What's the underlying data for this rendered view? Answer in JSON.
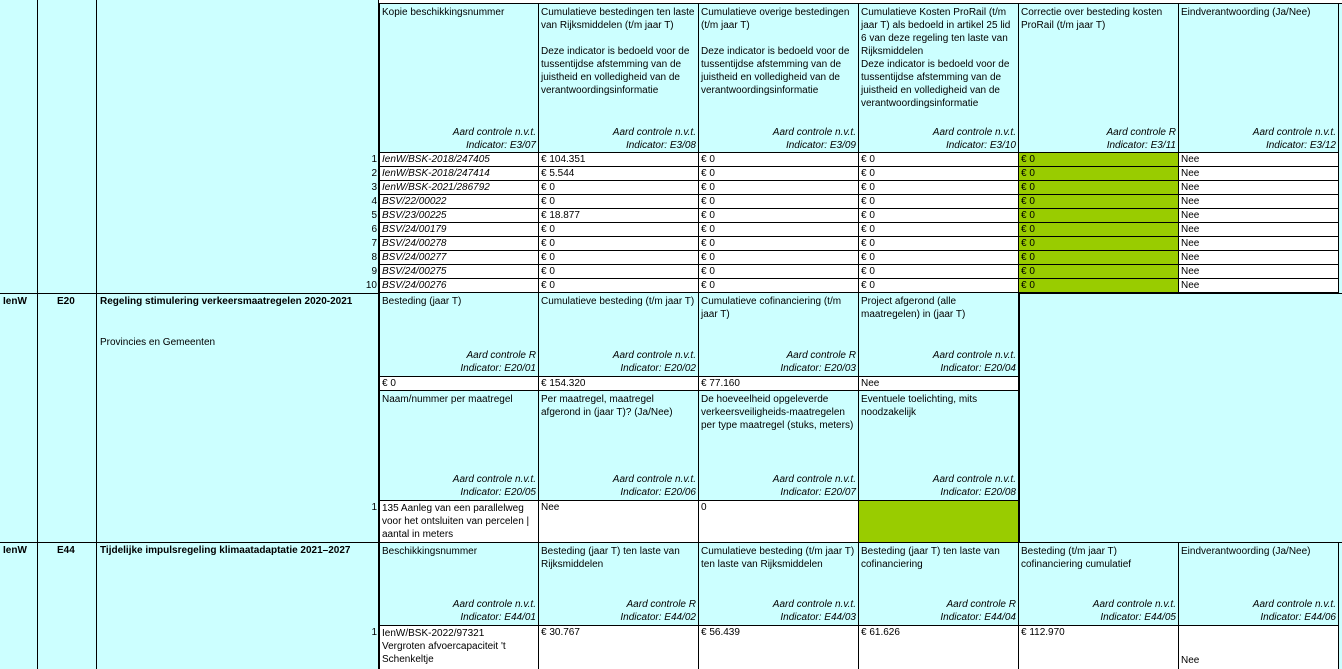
{
  "partial_top": [
    "IenW/BSK-2018/247405",
    "€ 0",
    "€ 0",
    "€ 0",
    "€ 0",
    "€ 0"
  ],
  "e3": {
    "headers": [
      {
        "label": "Kopie beschikkingsnummer",
        "aard": "Aard controle n.v.t.",
        "indicator": "Indicator: E3/07"
      },
      {
        "label": "Cumulatieve bestedingen ten laste van Rijksmiddelen (t/m jaar T)\n\nDeze indicator is bedoeld voor de tussentijdse afstemming van de juistheid en volledigheid van de verantwoordingsinformatie",
        "aard": "Aard controle n.v.t.",
        "indicator": "Indicator: E3/08"
      },
      {
        "label": "Cumulatieve overige bestedingen (t/m jaar T)\n\nDeze indicator is bedoeld voor de tussentijdse afstemming van de juistheid en volledigheid van de verantwoordingsinformatie",
        "aard": "Aard controle n.v.t.",
        "indicator": "Indicator: E3/09"
      },
      {
        "label": "Cumulatieve Kosten ProRail (t/m jaar T) als bedoeld in artikel 25 lid 6 van deze regeling ten laste van Rijksmiddelen\nDeze indicator is bedoeld voor de tussentijdse afstemming van de juistheid en volledigheid van de verantwoordingsinformatie",
        "aard": "Aard controle n.v.t.",
        "indicator": "Indicator: E3/10"
      },
      {
        "label": "Correctie over besteding kosten ProRail (t/m jaar T)",
        "aard": "Aard controle R",
        "indicator": "Indicator: E3/11"
      },
      {
        "label": "Eindverantwoording (Ja/Nee)",
        "aard": "Aard controle n.v.t.",
        "indicator": "Indicator: E3/12"
      }
    ],
    "rows": [
      {
        "n": "1",
        "nr": "IenW/BSK-2018/247405",
        "a": "€ 104.351",
        "b": "€ 0",
        "c": "€ 0",
        "d": "€ 0",
        "e": "Nee"
      },
      {
        "n": "2",
        "nr": "IenW/BSK-2018/247414",
        "a": "€ 5.544",
        "b": "€ 0",
        "c": "€ 0",
        "d": "€ 0",
        "e": "Nee"
      },
      {
        "n": "3",
        "nr": "IenW/BSK-2021/286792",
        "a": "€ 0",
        "b": "€ 0",
        "c": "€ 0",
        "d": "€ 0",
        "e": "Nee"
      },
      {
        "n": "4",
        "nr": "BSV/22/00022",
        "a": "€ 0",
        "b": "€ 0",
        "c": "€ 0",
        "d": "€ 0",
        "e": "Nee"
      },
      {
        "n": "5",
        "nr": "BSV/23/00225",
        "a": "€ 18.877",
        "b": "€ 0",
        "c": "€ 0",
        "d": "€ 0",
        "e": "Nee"
      },
      {
        "n": "6",
        "nr": "BSV/24/00179",
        "a": "€ 0",
        "b": "€ 0",
        "c": "€ 0",
        "d": "€ 0",
        "e": "Nee"
      },
      {
        "n": "7",
        "nr": "BSV/24/00278",
        "a": "€ 0",
        "b": "€ 0",
        "c": "€ 0",
        "d": "€ 0",
        "e": "Nee"
      },
      {
        "n": "8",
        "nr": "BSV/24/00277",
        "a": "€ 0",
        "b": "€ 0",
        "c": "€ 0",
        "d": "€ 0",
        "e": "Nee"
      },
      {
        "n": "9",
        "nr": "BSV/24/00275",
        "a": "€ 0",
        "b": "€ 0",
        "c": "€ 0",
        "d": "€ 0",
        "e": "Nee"
      },
      {
        "n": "10",
        "nr": "BSV/24/00276",
        "a": "€ 0",
        "b": "€ 0",
        "c": "€ 0",
        "d": "€ 0",
        "e": "Nee"
      }
    ],
    "highlight_color": "#99cc00"
  },
  "e20": {
    "ministry": "IenW",
    "code": "E20",
    "title": "Regeling stimulering verkeersmaatregelen 2020-2021",
    "recipients": "Provincies en Gemeenten",
    "headers1": [
      {
        "label": "Besteding (jaar T)",
        "aard": "Aard controle R",
        "indicator": "Indicator: E20/01"
      },
      {
        "label": "Cumulatieve besteding (t/m jaar T)",
        "aard": "Aard controle n.v.t.",
        "indicator": "Indicator: E20/02"
      },
      {
        "label": "Cumulatieve cofinanciering (t/m jaar T)",
        "aard": "Aard controle R",
        "indicator": "Indicator: E20/03"
      },
      {
        "label": "Project afgerond (alle maatregelen) in (jaar T)",
        "aard": "Aard controle n.v.t.",
        "indicator": "Indicator: E20/04"
      }
    ],
    "values1": [
      "€ 0",
      "€ 154.320",
      "€ 77.160",
      "Nee"
    ],
    "headers2": [
      {
        "label": "Naam/nummer per maatregel",
        "aard": "Aard controle n.v.t.",
        "indicator": "Indicator: E20/05"
      },
      {
        "label": "Per maatregel, maatregel afgerond in (jaar T)? (Ja/Nee)",
        "aard": "Aard controle n.v.t.",
        "indicator": "Indicator: E20/06"
      },
      {
        "label": "De hoeveelheid opgeleverde verkeersveiligheids-maatregelen per type maatregel (stuks, meters)",
        "aard": "Aard controle n.v.t.",
        "indicator": "Indicator: E20/07"
      },
      {
        "label": "Eventuele toelichting, mits noodzakelijk",
        "aard": "Aard controle n.v.t.",
        "indicator": "Indicator: E20/08"
      }
    ],
    "row": {
      "n": "1",
      "name": "135 Aanleg van een parallelweg voor het ontsluiten van percelen | aantal in meters",
      "afgerond": "Nee",
      "hoeveelheid": "0",
      "toelichting": ""
    }
  },
  "e44": {
    "ministry": "IenW",
    "code": "E44",
    "title": "Tijdelijke impulsregeling klimaatadaptatie 2021–2027",
    "headers": [
      {
        "label": "Beschikkingsnummer",
        "aard": "Aard controle n.v.t.",
        "indicator": "Indicator: E44/01"
      },
      {
        "label": "Besteding (jaar T) ten laste van Rijksmiddelen",
        "aard": "Aard controle R",
        "indicator": "Indicator: E44/02"
      },
      {
        "label": "Cumulatieve besteding (t/m jaar T) ten laste van Rijksmiddelen",
        "aard": "Aard controle n.v.t.",
        "indicator": "Indicator: E44/03"
      },
      {
        "label": "Besteding (jaar T) ten laste van cofinanciering",
        "aard": "Aard controle R",
        "indicator": "Indicator: E44/04"
      },
      {
        "label": "Besteding (t/m jaar T) cofinanciering cumulatief",
        "aard": "Aard controle n.v.t.",
        "indicator": "Indicator: E44/05"
      },
      {
        "label": "Eindverantwoording (Ja/Nee)",
        "aard": "Aard controle n.v.t.",
        "indicator": "Indicator: E44/06"
      }
    ],
    "row": {
      "n": "1",
      "nr": "IenW/BSK-2022/97321\nVergroten afvoercapaciteit  't Schenkeltje",
      "a": "€ 30.767",
      "b": "€ 56.439",
      "c": "€ 61.626",
      "d": "€ 112.970",
      "e": "Nee"
    }
  },
  "colors": {
    "cyan": "#ccffff",
    "green": "#99cc00",
    "white": "#ffffff"
  }
}
